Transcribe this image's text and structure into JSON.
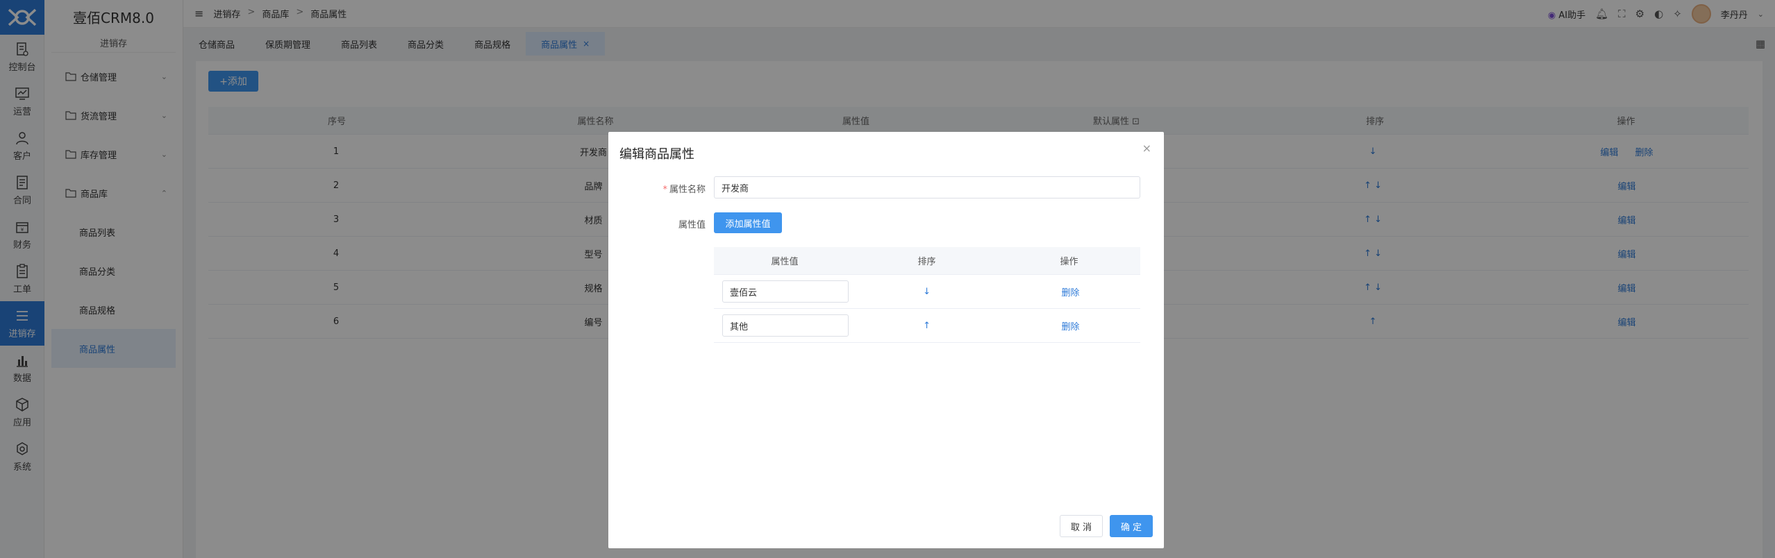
{
  "rail": {
    "items": [
      {
        "label": "控制台",
        "icon": "dashboard-icon"
      },
      {
        "label": "运营",
        "icon": "chart-line-icon"
      },
      {
        "label": "客户",
        "icon": "user-icon"
      },
      {
        "label": "合同",
        "icon": "document-icon"
      },
      {
        "label": "财务",
        "icon": "wallet-icon"
      },
      {
        "label": "工单",
        "icon": "clipboard-icon"
      },
      {
        "label": "进销存",
        "icon": "list-icon"
      },
      {
        "label": "数据",
        "icon": "bar-chart-icon"
      },
      {
        "label": "应用",
        "icon": "cube-icon"
      },
      {
        "label": "系统",
        "icon": "gear-icon"
      }
    ]
  },
  "sidebar": {
    "brand": "壹佰CRM8.0",
    "subtitle": "进销存",
    "groups": [
      {
        "label": "仓储管理",
        "chevron": "⌄"
      },
      {
        "label": "货流管理",
        "chevron": "⌄"
      },
      {
        "label": "库存管理",
        "chevron": "⌄"
      },
      {
        "label": "商品库",
        "chevron": "⌃"
      }
    ],
    "leaves": [
      "商品列表",
      "商品分类",
      "商品规格",
      "商品属性"
    ]
  },
  "topbar": {
    "menu_icon": "≡",
    "crumbs": [
      "进销存",
      "商品库",
      "商品属性"
    ],
    "crumb_sep": ">",
    "ai": "AI助手",
    "user": "李丹丹"
  },
  "tabs": {
    "items": [
      "仓储商品",
      "保质期管理",
      "商品列表",
      "商品分类",
      "商品规格",
      "商品属性"
    ],
    "close": "×"
  },
  "page": {
    "add_label": "+添加",
    "headers": [
      "序号",
      "属性名称",
      "属性值",
      "默认属性 ⊡",
      "排序",
      "操作"
    ],
    "rows": [
      {
        "no": "1",
        "name": "开发商",
        "sort": "↓",
        "edit": "编辑",
        "del": "删除"
      },
      {
        "no": "2",
        "name": "品牌",
        "sort": "↑ ↓",
        "edit": "编辑",
        "del": ""
      },
      {
        "no": "3",
        "name": "材质",
        "sort": "↑ ↓",
        "edit": "编辑",
        "del": ""
      },
      {
        "no": "4",
        "name": "型号",
        "sort": "↑ ↓",
        "edit": "编辑",
        "del": ""
      },
      {
        "no": "5",
        "name": "规格",
        "sort": "↑ ↓",
        "edit": "编辑",
        "del": ""
      },
      {
        "no": "6",
        "name": "编号",
        "sort": "↑",
        "edit": "编辑",
        "del": ""
      }
    ]
  },
  "dialog": {
    "title": "编辑商品属性",
    "close": "×",
    "name_label": "属性名称",
    "required_mark": "*",
    "name_value": "开发商",
    "values_label": "属性值",
    "add_value_label": "添加属性值",
    "sub_headers": [
      "属性值",
      "排序",
      "操作"
    ],
    "sub_rows": [
      {
        "value": "壹佰云",
        "sort": "↓",
        "action": "删除"
      },
      {
        "value": "其他",
        "sort": "↑",
        "action": "删除"
      }
    ],
    "cancel_label": "取 消",
    "confirm_label": "确 定"
  },
  "colors": {
    "accent": "#2f7bd8",
    "primary_button": "#3f95ee"
  }
}
